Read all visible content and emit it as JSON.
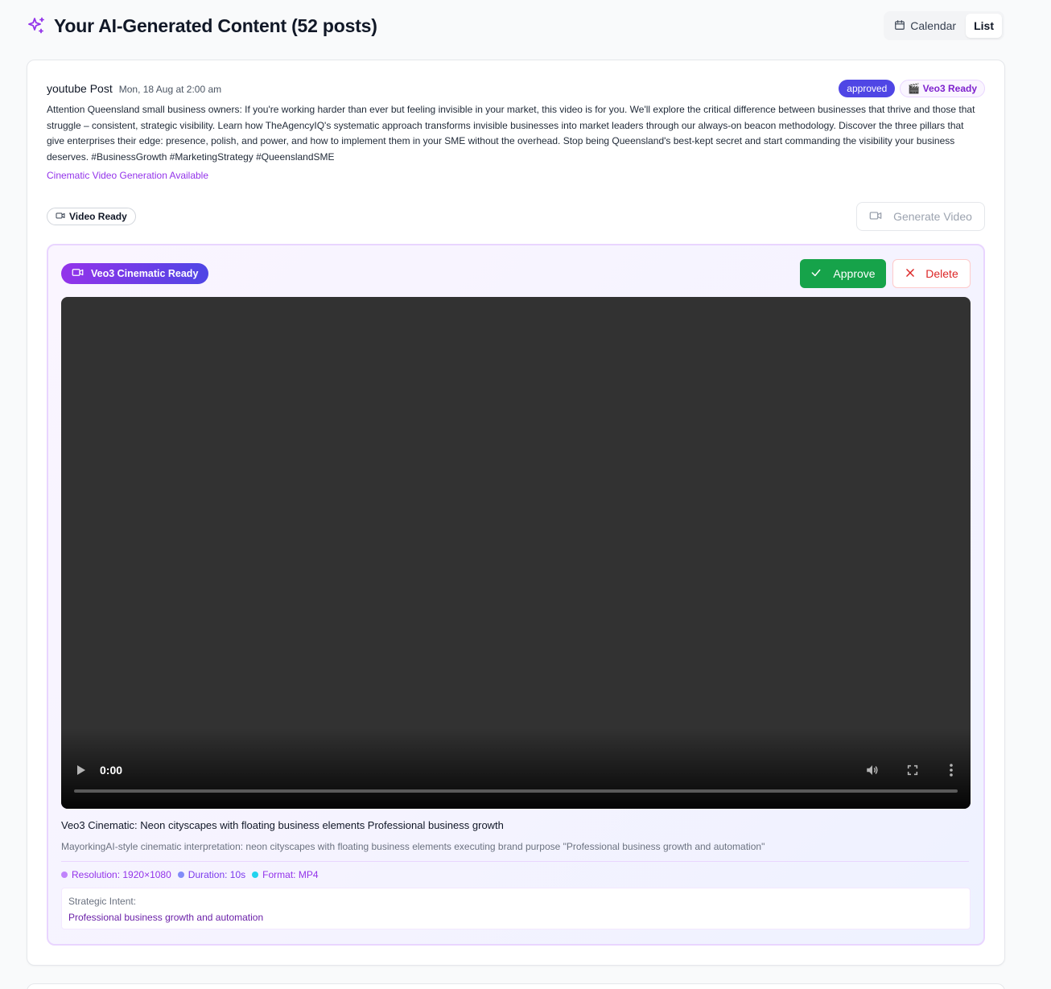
{
  "header": {
    "title": "Your AI-Generated Content (52 posts)",
    "views": [
      {
        "label": "Calendar",
        "icon": "calendar-icon",
        "active": false
      },
      {
        "label": "List",
        "active": true
      }
    ]
  },
  "post": {
    "platform": "youtube Post",
    "date": "Mon, 18 Aug at 2:00 am",
    "status": "approved",
    "veo_badge": "🎬 Veo3 Ready",
    "body": "Attention Queensland small business owners: If you're working harder than ever but feeling invisible in your market, this video is for you. We'll explore the critical difference between businesses that thrive and those that struggle – consistent, strategic visibility. Learn how TheAgencyIQ's systematic approach transforms invisible businesses into market leaders through our always-on beacon methodology. Discover the three pillars that give enterprises their edge: presence, polish, and power, and how to implement them in your SME without the overhead. Stop being Queensland's best-kept secret and start commanding the visibility your business deserves. #BusinessGrowth #MarketingStrategy #QueenslandSME",
    "cinematic_link": "Cinematic Video Generation Available",
    "video_ready_label": "Video Ready",
    "generate_label": "Generate Video"
  },
  "veo": {
    "pill_label": "Veo3 Cinematic Ready",
    "approve_label": "Approve",
    "delete_label": "Delete",
    "player": {
      "time": "0:00",
      "progress": 0
    },
    "title": "Veo3 Cinematic: Neon cityscapes with floating business elements Professional business growth",
    "description": "MayorkingAI-style cinematic interpretation: neon cityscapes with floating business elements executing brand purpose \"Professional business growth and automation\"",
    "specs": [
      {
        "label": "Resolution: 1920×1080",
        "color": "#c084fc",
        "text_color": "#9333ea"
      },
      {
        "label": "Duration: 10s",
        "color": "#818cf8",
        "text_color": "#4f46e5"
      },
      {
        "label": "Format: MP4",
        "color": "#22d3ee",
        "text_color": "#9333ea"
      }
    ],
    "intent_label": "Strategic Intent:",
    "intent_value": "Professional business growth and automation"
  },
  "colors": {
    "brand_purple": "#9333ea",
    "approved_badge": "#4f46e5",
    "approve_green": "#16a34a",
    "delete_red": "#dc2626"
  }
}
